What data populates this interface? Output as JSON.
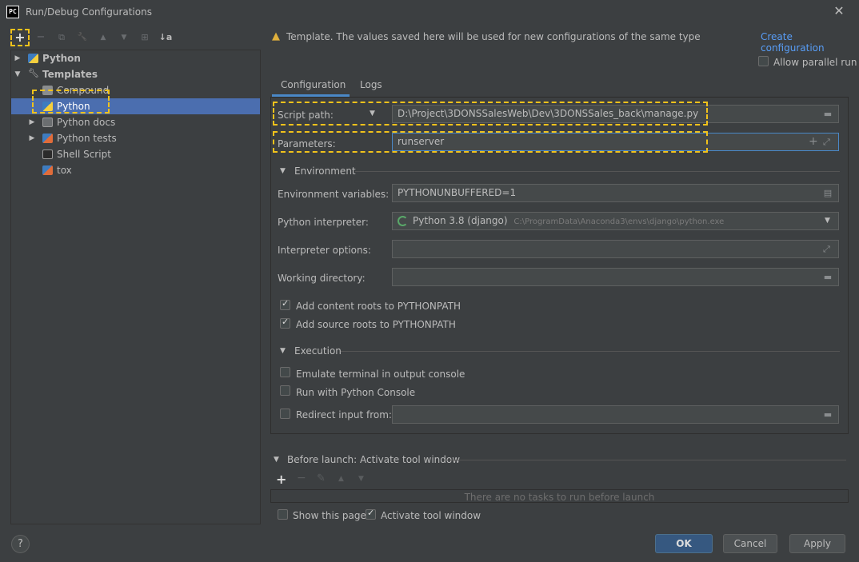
{
  "window": {
    "title": "Run/Debug Configurations",
    "app_icon": "PC",
    "close": "✕"
  },
  "toolbar": {
    "add": "+",
    "remove": "−",
    "copy": "⧉",
    "edit": "🔧",
    "move_up": "▲",
    "move_down": "▼",
    "folder": "⊞",
    "sort": "↓a"
  },
  "tree": {
    "items": [
      {
        "label": "Python",
        "bold": true
      },
      {
        "label": "Templates",
        "bold": true
      },
      {
        "label": "Compound"
      },
      {
        "label": "Python",
        "selected": true
      },
      {
        "label": "Python docs"
      },
      {
        "label": "Python tests"
      },
      {
        "label": "Shell Script"
      },
      {
        "label": "tox"
      }
    ]
  },
  "banner": {
    "text": "Template. The values saved here will be used for new configurations of the same type",
    "link": "Create configuration"
  },
  "allow_parallel": {
    "label": "Allow parallel run",
    "checked": false
  },
  "tabs": {
    "configuration": "Configuration",
    "logs": "Logs"
  },
  "form": {
    "script_path_label": "Script path:",
    "script_path_value": "D:\\Project\\3DONSSalesWeb\\Dev\\3DONSSales_back\\manage.py",
    "parameters_label": "Parameters:",
    "parameters_value": "runserver",
    "environment_section": "Environment",
    "env_vars_label": "Environment variables:",
    "env_vars_value": "PYTHONUNBUFFERED=1",
    "interpreter_label": "Python interpreter:",
    "interpreter_name": "Python 3.8 (django)",
    "interpreter_path": "C:\\ProgramData\\Anaconda3\\envs\\django\\python.exe",
    "interpreter_options_label": "Interpreter options:",
    "working_dir_label": "Working directory:",
    "add_content_roots": "Add content roots to PYTHONPATH",
    "add_source_roots": "Add source roots to PYTHONPATH",
    "execution_section": "Execution",
    "emulate_terminal": "Emulate terminal in output console",
    "run_with_console": "Run with Python Console",
    "redirect_input": "Redirect input from:"
  },
  "before_launch": {
    "title": "Before launch: Activate tool window",
    "empty": "There are no tasks to run before launch",
    "add": "+",
    "remove": "−",
    "edit": "✎",
    "up": "▲",
    "down": "▼"
  },
  "footer": {
    "show_page": "Show this page",
    "activate_tool_window": "Activate tool window",
    "ok": "OK",
    "cancel": "Cancel",
    "apply": "Apply",
    "help": "?"
  }
}
